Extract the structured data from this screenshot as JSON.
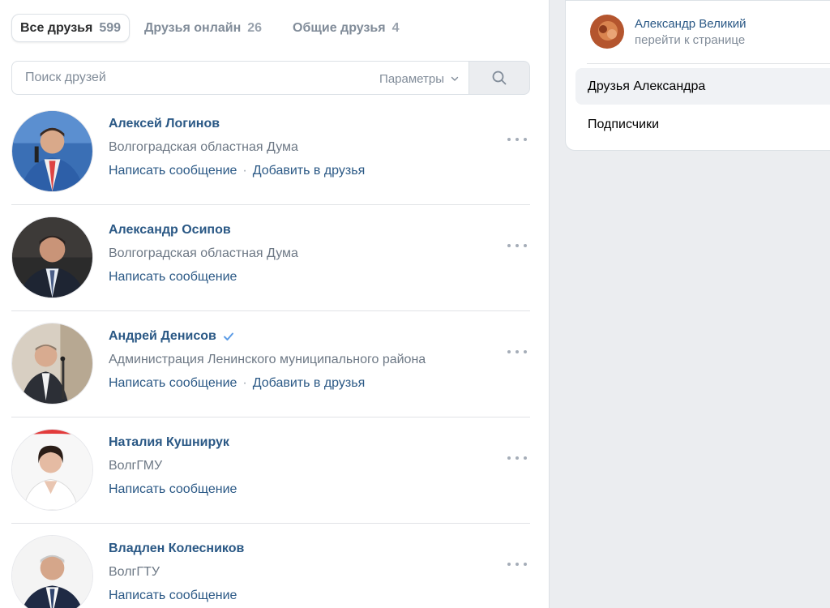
{
  "tabs": [
    {
      "label": "Все друзья",
      "count": "599"
    },
    {
      "label": "Друзья онлайн",
      "count": "26"
    },
    {
      "label": "Общие друзья",
      "count": "4"
    }
  ],
  "search": {
    "placeholder": "Поиск друзей",
    "params_label": "Параметры"
  },
  "friends": [
    {
      "name": "Алексей Логинов",
      "desc": "Волгоградская областная Дума",
      "action1": "Написать сообщение",
      "action2": "Добавить в друзья"
    },
    {
      "name": "Александр Осипов",
      "desc": "Волгоградская областная Дума",
      "action1": "Написать сообщение"
    },
    {
      "name": "Андрей Денисов",
      "desc": "Администрация Ленинского муниципального района",
      "action1": "Написать сообщение",
      "action2": "Добавить в друзья",
      "verified": true
    },
    {
      "name": "Наталия Кушнирук",
      "desc": "ВолгГМУ",
      "action1": "Написать сообщение"
    },
    {
      "name": "Владлен Колесников",
      "desc": "ВолгГТУ",
      "action1": "Написать сообщение"
    }
  ],
  "sidebar": {
    "owner_name": "Александр Великий",
    "owner_link": "перейти к странице",
    "items": [
      {
        "label": "Друзья Александра",
        "active": true
      },
      {
        "label": "Подписчики",
        "active": false
      }
    ]
  },
  "colors": {
    "link": "#2a5885",
    "muted": "#818c99",
    "background": "#ebedf0",
    "verified": "#5c9ce6"
  }
}
